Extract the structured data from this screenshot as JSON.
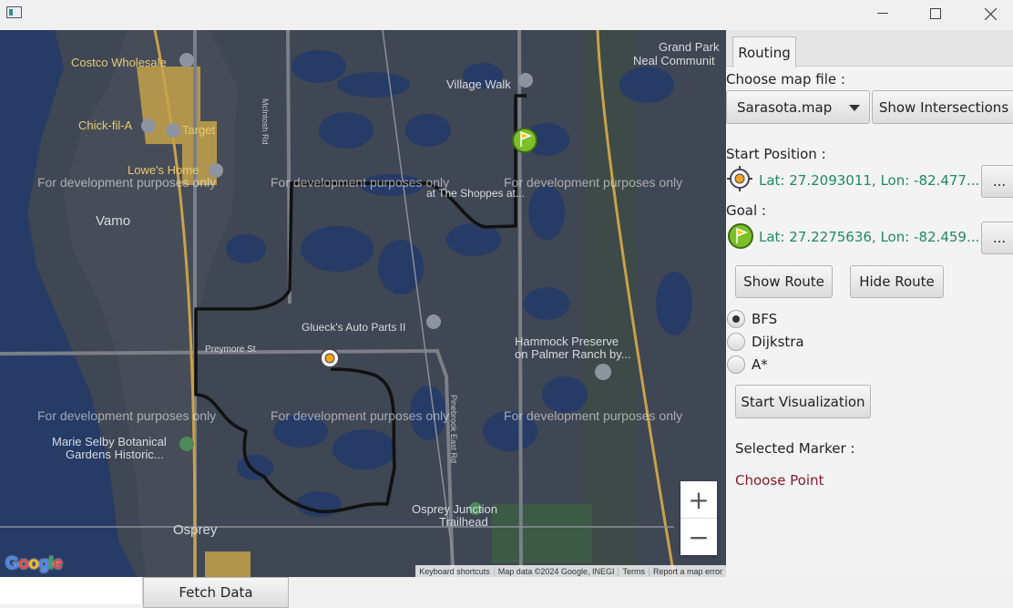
{
  "window": {
    "minimize_icon": "minimize-icon",
    "maximize_icon": "maximize-icon",
    "close_icon": "close-icon"
  },
  "map": {
    "watermark": "For development purposes only",
    "labels": {
      "costco": "Costco Wholesale",
      "chick": "Chick-fil-A",
      "target": "Target",
      "lowes": "Lowe's Home",
      "vamo": "Vamo",
      "village_walk": "Village Walk",
      "grand_park": "Grand Park",
      "neal": "Neal Communit",
      "glueck": "Glueck's Auto Parts II",
      "preymore": "Preymore St",
      "hammock1": "Hammock Preserve",
      "hammock2": "on Palmer Ranch by...",
      "marie1": "Marie Selby Botanical",
      "marie2": "Gardens Historic...",
      "osprey": "Osprey",
      "osprey_junction1": "Osprey Junction",
      "osprey_junction2": "Trailhead",
      "shoppes": "at The Shoppes at...",
      "mcintosh": "McIntosh Rd",
      "pinebrook": "Pinebrook East Rd"
    },
    "zoom_in": "+",
    "zoom_out": "−",
    "google": "Google",
    "attribution": [
      "Keyboard shortcuts",
      "Map data ©2024 Google, INEGI",
      "Terms",
      "Report a map error"
    ]
  },
  "panel": {
    "tab_label": "Routing",
    "choose_map_label": "Choose map file :",
    "map_file_selected": "Sarasota.map",
    "show_intersections": "Show Intersections",
    "start_label": "Start Position :",
    "start_coords": "Lat: 27.2093011, Lon: -82.477...",
    "goal_label": "Goal :",
    "goal_coords": "Lat: 27.2275636, Lon: -82.459...",
    "ellipsis_button": "...",
    "show_route": "Show Route",
    "hide_route": "Hide Route",
    "algorithms": [
      "BFS",
      "Dijkstra",
      "A*"
    ],
    "selected_algorithm": "BFS",
    "start_visualization": "Start Visualization",
    "selected_marker_label": "Selected Marker :",
    "choose_point": "Choose Point",
    "choose_point_color": "#8b1a2b",
    "coord_color": "#1f8a62"
  },
  "bottom": {
    "fetch_data": "Fetch Data"
  }
}
